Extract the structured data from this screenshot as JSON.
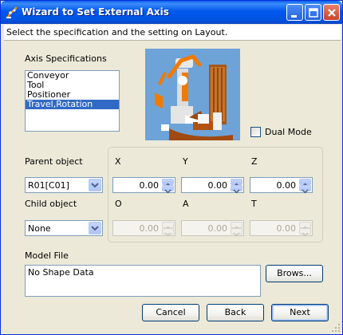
{
  "window": {
    "title": "Wizard to Set External Axis"
  },
  "header": {
    "instruction": "Select the specification and the setting on Layout."
  },
  "axis_spec": {
    "label": "Axis Specifications",
    "items": [
      "Conveyor",
      "Tool",
      "Positioner",
      "Travel,Rotation"
    ],
    "selected": "Travel,Rotation"
  },
  "dual_mode": {
    "label": "Dual Mode",
    "checked": false
  },
  "parent": {
    "label": "Parent object",
    "value": "R01[C01]"
  },
  "child": {
    "label": "Child object",
    "value": "None"
  },
  "coords": {
    "x": {
      "label": "X",
      "value": "0.00"
    },
    "y": {
      "label": "Y",
      "value": "0.00"
    },
    "z": {
      "label": "Z",
      "value": "0.00"
    }
  },
  "orient": {
    "o": {
      "label": "O",
      "value": "0.00"
    },
    "a": {
      "label": "A",
      "value": "0.00"
    },
    "t": {
      "label": "T",
      "value": "0.00"
    }
  },
  "model_file": {
    "label": "Model File",
    "value": "No Shape Data",
    "browse_label": "Brows..."
  },
  "footer": {
    "cancel_label": "Cancel",
    "back_label": "Back",
    "next_label": "Next"
  },
  "colors": {
    "titlebar": "#0054e3",
    "selection": "#316ac5",
    "dialog_bg": "#ece9d8"
  }
}
